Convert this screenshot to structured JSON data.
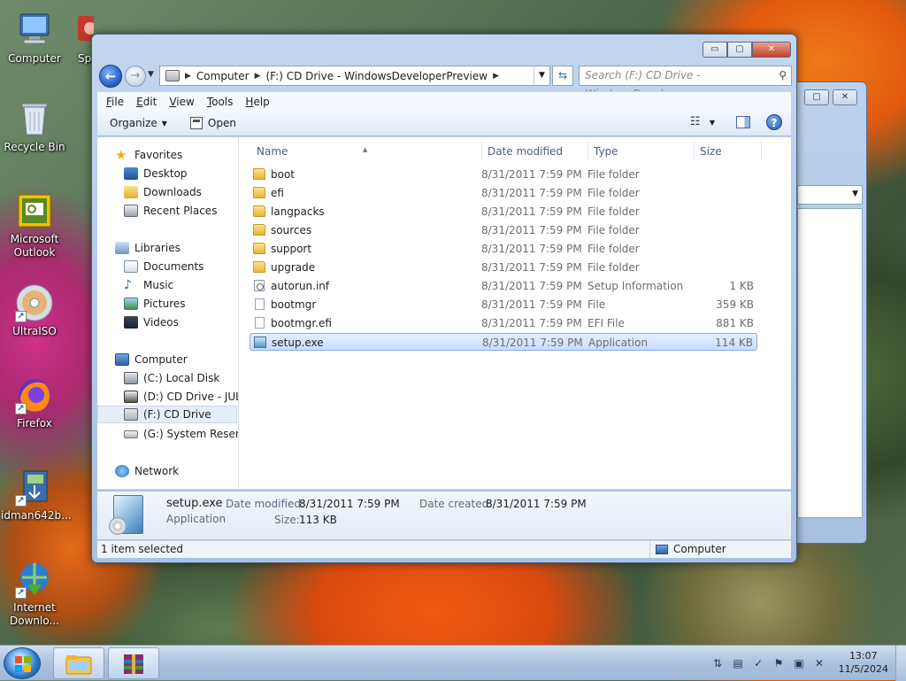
{
  "desktop": {
    "icons": [
      {
        "label": "Computer",
        "icon": "computer-icon"
      },
      {
        "label": "Sp",
        "icon": "app-icon"
      },
      {
        "label": "Recycle Bin",
        "icon": "recycle-bin-icon"
      },
      {
        "label": "Microsoft Outlook",
        "icon": "outlook-icon"
      },
      {
        "label": "UltraISO",
        "icon": "disc-icon"
      },
      {
        "label": "Firefox",
        "icon": "firefox-icon"
      },
      {
        "label": "idman642b...",
        "icon": "installer-icon"
      },
      {
        "label": "Internet Downlo...",
        "icon": "idm-icon"
      }
    ]
  },
  "window": {
    "caption_buttons": {
      "minimize": "▭",
      "maximize": "▢",
      "close": "✕"
    },
    "address": {
      "crumbs": [
        "Computer",
        "(F:) CD Drive - WindowsDeveloperPreview"
      ]
    },
    "search": {
      "placeholder": "Search (F:) CD Drive - WindowsDevel..."
    },
    "menu": [
      "File",
      "Edit",
      "View",
      "Tools",
      "Help"
    ],
    "toolbar": {
      "organize": "Organize",
      "open": "Open"
    },
    "nav": {
      "favorites": "Favorites",
      "desktop": "Desktop",
      "downloads": "Downloads",
      "recent": "Recent Places",
      "libraries": "Libraries",
      "documents": "Documents",
      "music": "Music",
      "pictures": "Pictures",
      "videos": "Videos",
      "computer": "Computer",
      "c_drive": "(C:) Local Disk",
      "d_drive": "(D:) CD Drive - JULIA",
      "f_drive": "(F:) CD Drive",
      "g_drive": "(G:) System Reserved",
      "network": "Network"
    },
    "columns": {
      "name": "Name",
      "date": "Date modified",
      "type": "Type",
      "size": "Size"
    },
    "files": [
      {
        "name": "boot",
        "date": "8/31/2011 7:59 PM",
        "type": "File folder",
        "size": "",
        "icon": "folder"
      },
      {
        "name": "efi",
        "date": "8/31/2011 7:59 PM",
        "type": "File folder",
        "size": "",
        "icon": "folder"
      },
      {
        "name": "langpacks",
        "date": "8/31/2011 7:59 PM",
        "type": "File folder",
        "size": "",
        "icon": "folder"
      },
      {
        "name": "sources",
        "date": "8/31/2011 7:59 PM",
        "type": "File folder",
        "size": "",
        "icon": "folder"
      },
      {
        "name": "support",
        "date": "8/31/2011 7:59 PM",
        "type": "File folder",
        "size": "",
        "icon": "folder"
      },
      {
        "name": "upgrade",
        "date": "8/31/2011 7:59 PM",
        "type": "File folder",
        "size": "",
        "icon": "folder"
      },
      {
        "name": "autorun.inf",
        "date": "8/31/2011 7:59 PM",
        "type": "Setup Information",
        "size": "1 KB",
        "icon": "inf"
      },
      {
        "name": "bootmgr",
        "date": "8/31/2011 7:59 PM",
        "type": "File",
        "size": "359 KB",
        "icon": "file"
      },
      {
        "name": "bootmgr.efi",
        "date": "8/31/2011 7:59 PM",
        "type": "EFI File",
        "size": "881 KB",
        "icon": "file"
      },
      {
        "name": "setup.exe",
        "date": "8/31/2011 7:59 PM",
        "type": "Application",
        "size": "114 KB",
        "icon": "app",
        "selected": true
      }
    ],
    "details": {
      "name": "setup.exe",
      "kind": "Application",
      "modified_label": "Date modified:",
      "modified_value": "8/31/2011 7:59 PM",
      "size_label": "Size:",
      "size_value": "113 KB",
      "created_label": "Date created:",
      "created_value": "8/31/2011 7:59 PM"
    },
    "status": {
      "left": "1 item selected",
      "right": "Computer"
    }
  },
  "taskbar": {
    "time": "13:07",
    "date": "11/5/2024"
  }
}
